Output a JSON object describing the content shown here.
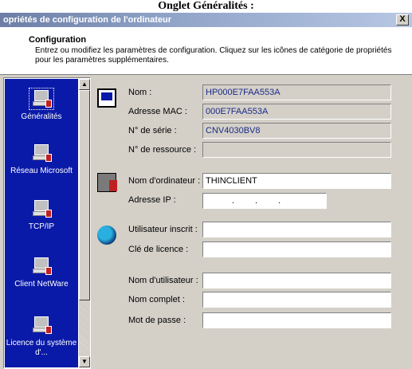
{
  "caption": "Onglet Généralités :",
  "window": {
    "title": "opriétés de configuration de l'ordinateur",
    "close_label": "X"
  },
  "header": {
    "title": "Configuration",
    "description": "Entrez ou modifiez les paramètres de configuration. Cliquez sur les icônes de catégorie de propriétés pour les paramètres supplémentaires."
  },
  "sidebar": {
    "items": [
      {
        "label": "Généralités",
        "icon": "computer-settings-icon",
        "selected": true
      },
      {
        "label": "Réseau Microsoft",
        "icon": "network-computer-icon",
        "selected": false
      },
      {
        "label": "TCP/IP",
        "icon": "tcpip-computer-icon",
        "selected": false
      },
      {
        "label": "Client NetWare",
        "icon": "netware-client-icon",
        "selected": false
      },
      {
        "label": "Licence du système d'...",
        "icon": "license-computer-icon",
        "selected": false
      }
    ],
    "scroll_up": "▲",
    "scroll_down": "▼"
  },
  "general": {
    "nom_label": "Nom :",
    "nom_value": "HP000E7FAA553A",
    "mac_label": "Adresse MAC :",
    "mac_value": "000E7FAA553A",
    "serial_label": "N° de série :",
    "serial_value": "CNV4030BV8",
    "resource_label": "N° de ressource :",
    "resource_value": "",
    "computer_name_label": "Nom d'ordinateur :",
    "computer_name_value": "THINCLIENT",
    "ip_label": "Adresse IP :",
    "ip_value": "...",
    "registered_user_label": "Utilisateur inscrit :",
    "registered_user_value": "",
    "license_key_label": "Clé de licence :",
    "license_key_value": "",
    "username_label": "Nom d'utilisateur :",
    "username_value": "",
    "fullname_label": "Nom complet :",
    "fullname_value": "",
    "password_label": "Mot de passe :",
    "password_value": ""
  },
  "colors": {
    "sidebar_bg": "#0a1aa8",
    "dialog_bg": "#d4d0c8",
    "readonly_text": "#1a2a8a"
  }
}
